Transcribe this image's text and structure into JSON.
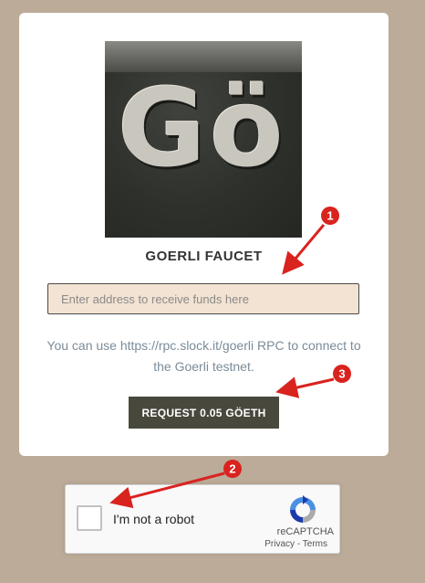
{
  "faucet": {
    "logo_text": "Gö",
    "title": "GOERLI FAUCET",
    "address_placeholder": "Enter address to receive funds here",
    "info_text": "You can use https://rpc.slock.it/goerli RPC to connect to the Goerli testnet.",
    "request_button_label": "REQUEST 0.05 GÖETH"
  },
  "recaptcha": {
    "label": "I'm not a robot",
    "brand": "reCAPTCHA",
    "privacy_link": "Privacy",
    "separator": " - ",
    "terms_link": "Terms"
  },
  "annotations": {
    "marker_1": "1",
    "marker_2": "2",
    "marker_3": "3",
    "color": "#d9231f"
  },
  "colors": {
    "background": "#bcab98",
    "card": "#ffffff",
    "input_bg": "#f3e3d2",
    "button_bg": "#48483c",
    "info_text": "#7a8c99"
  }
}
